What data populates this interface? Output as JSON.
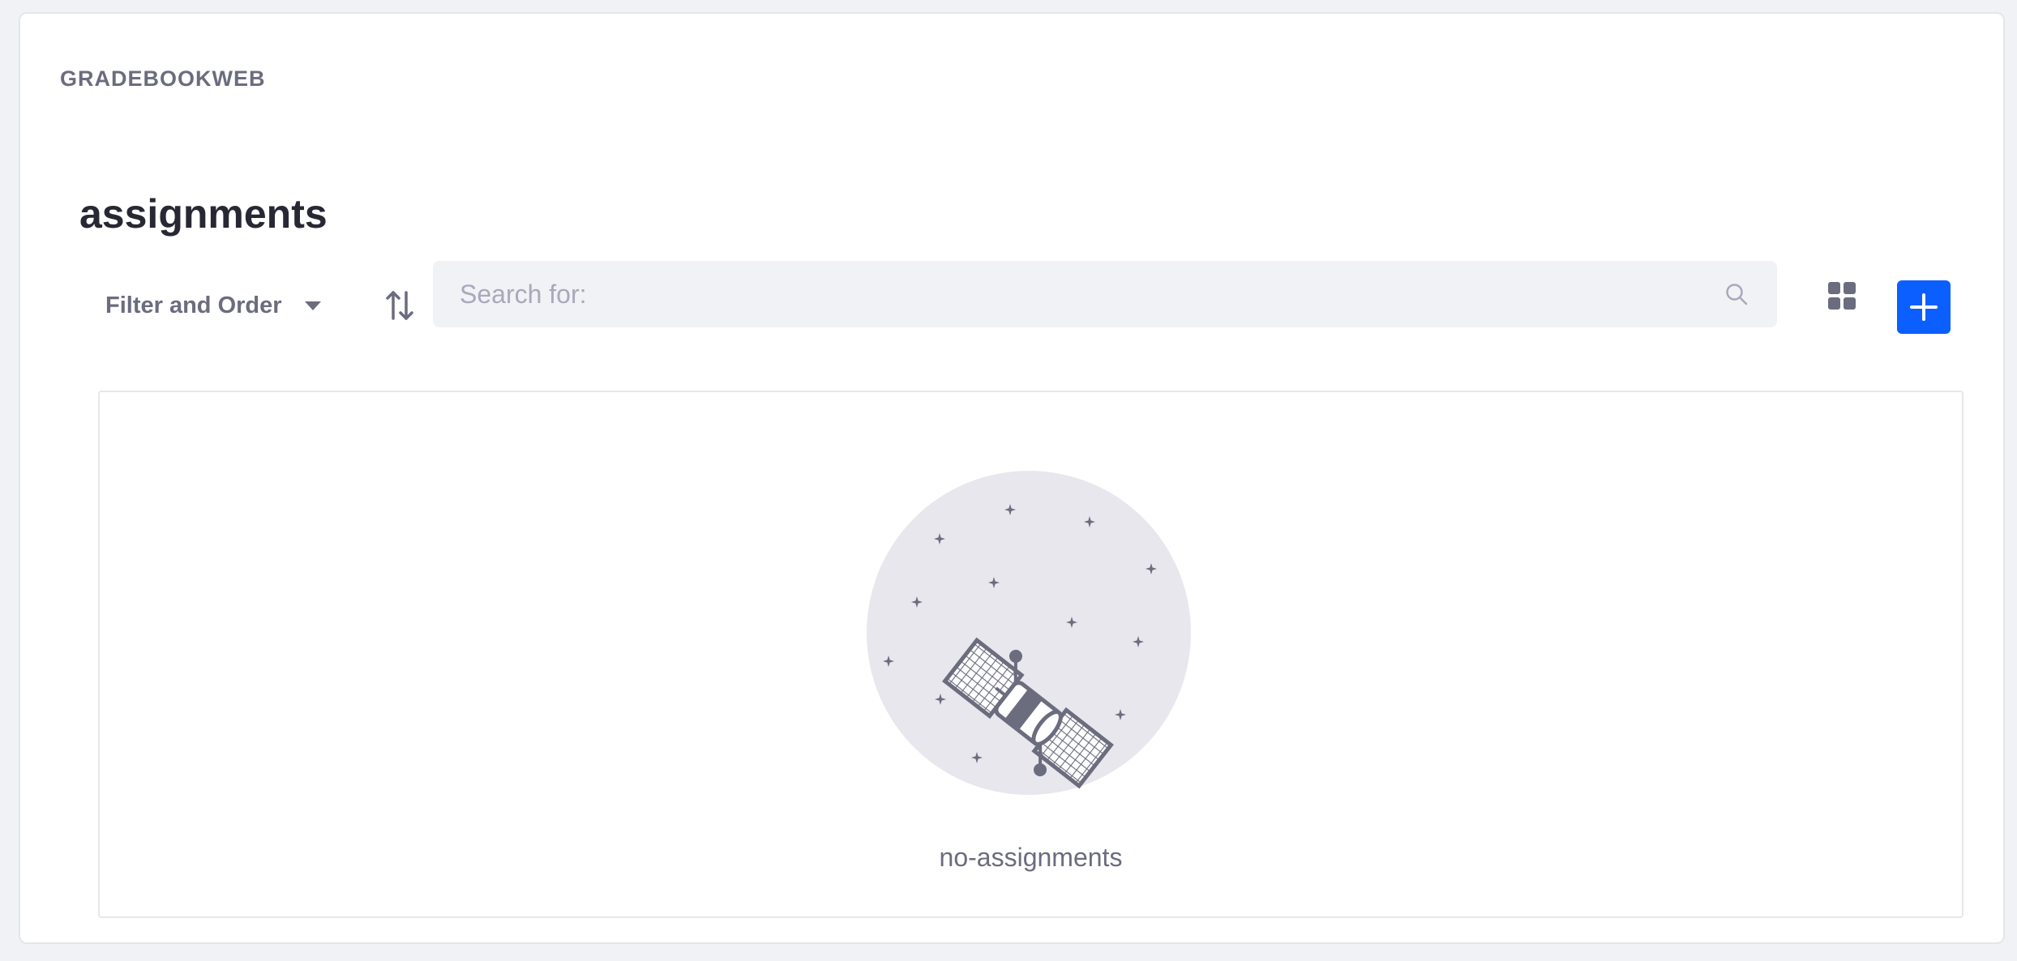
{
  "portlet": {
    "title": "GRADEBOOKWEB"
  },
  "page": {
    "title": "assignments"
  },
  "toolbar": {
    "filter_label": "Filter and Order",
    "filter_icon": "caret-down-icon",
    "sort_icon": "order-arrows-icon",
    "search_placeholder": "Search for:",
    "search_value": "",
    "search_icon": "search-icon",
    "view_icon": "cards-grid-icon",
    "add_icon": "plus-icon"
  },
  "empty_state": {
    "illustration": "satellite-icon",
    "message": "no-assignments"
  },
  "colors": {
    "primary": "#0b5fff",
    "text_secondary": "#6b6c7e",
    "text_dark": "#272833",
    "search_bg": "#f1f2f5",
    "illustration_bg": "#e7e7ed"
  }
}
